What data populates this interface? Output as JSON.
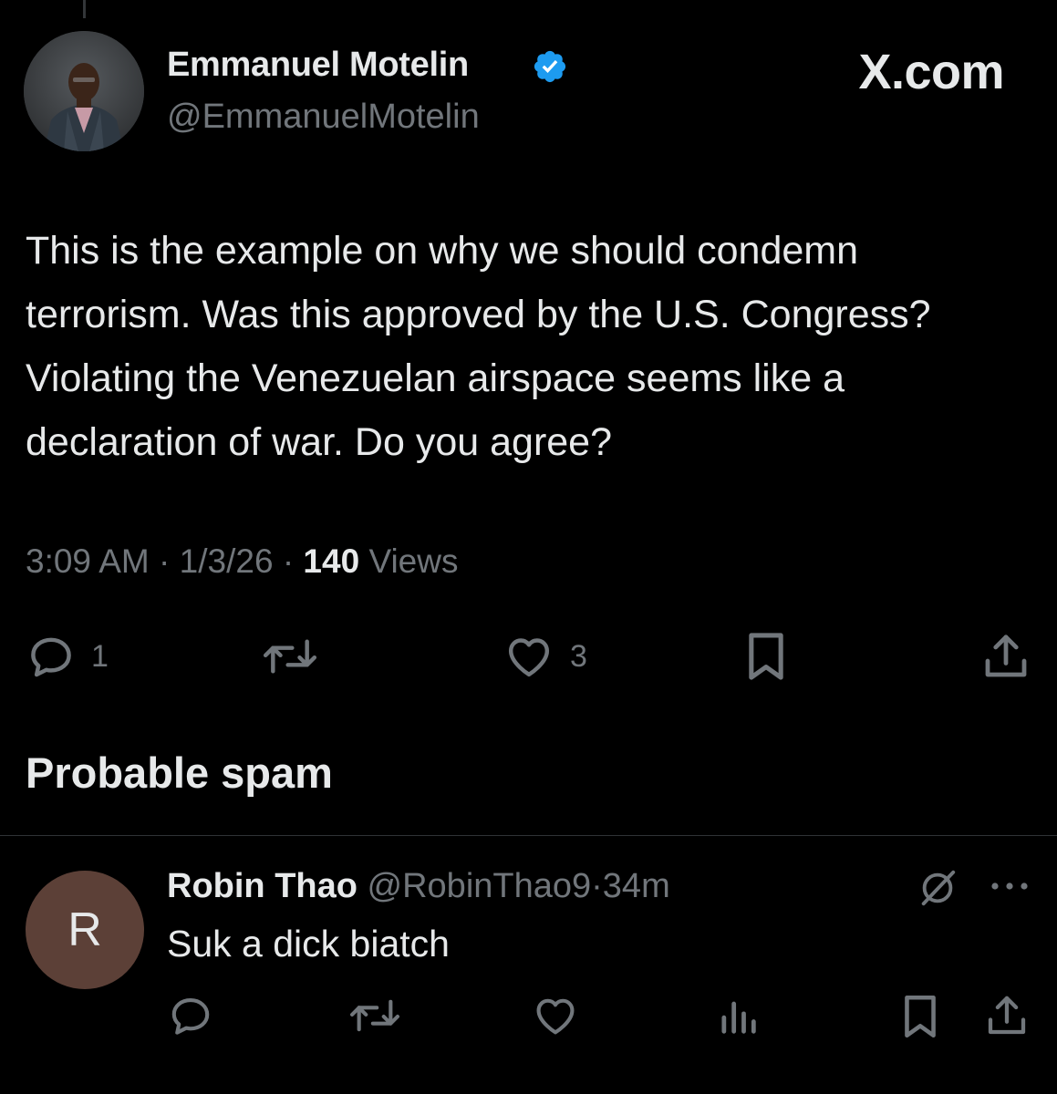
{
  "tweet": {
    "author": {
      "name": "Emmanuel Motelin",
      "handle": "@EmmanuelMotelin",
      "verified": true
    },
    "brand": "X.com",
    "text": "This is the example on why we should condemn terrorism. Was this approved by the U.S. Congress? Violating the Venezuelan airspace seems like a declaration of war. Do you agree?",
    "time": "3:09 AM",
    "separator": "·",
    "date": "1/3/26",
    "views_count": "140",
    "views_label": "Views",
    "actions": {
      "reply_icon": "reply-icon",
      "reply_count": "1",
      "repost_icon": "repost-icon",
      "like_icon": "heart-icon",
      "like_count": "3",
      "bookmark_icon": "bookmark-icon",
      "share_icon": "share-icon"
    }
  },
  "section_title": "Probable spam",
  "reply": {
    "avatar_letter": "R",
    "name": "Robin Thao",
    "handle": "@RobinThao9",
    "separator": "·",
    "time": "34m",
    "text": "Suk a dick biatch",
    "icons": [
      "grok-icon",
      "more-icon",
      "reply-icon",
      "repost-icon",
      "heart-icon",
      "analytics-icon",
      "bookmark-icon",
      "share-icon"
    ]
  },
  "colors": {
    "background": "#000000",
    "text_primary": "#e7e9ea",
    "text_secondary": "#71767b",
    "verified_blue": "#1d9bf0",
    "divider": "#2f3336",
    "reply_avatar_bg": "#5c4037"
  }
}
